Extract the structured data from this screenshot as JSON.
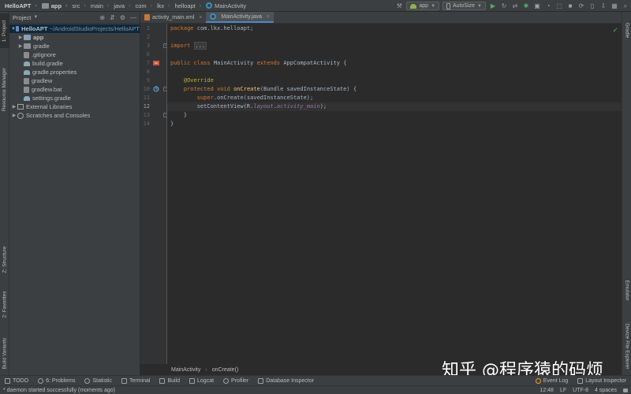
{
  "navbar": {
    "crumbs": [
      "HelloAPT",
      "app",
      "src",
      "main",
      "java",
      "com",
      "lkx",
      "helloapt",
      "MainActivity"
    ],
    "run_config": "app",
    "device": "AutoSize"
  },
  "left_strip": {
    "tabs": [
      "1: Project",
      "Resource Manager",
      "Z: Structure",
      "2: Favorites",
      "Build Variants"
    ]
  },
  "right_strip": {
    "tabs": [
      "Gradle",
      "Emulator",
      "Device File Explorer"
    ]
  },
  "project_panel": {
    "title": "Project",
    "tree": [
      {
        "label": "HelloAPT",
        "suffix": "~/AndroidStudioProjects/HelloAPT",
        "icon": "folder",
        "indent": 0,
        "expanded": true,
        "bold": true
      },
      {
        "label": "app",
        "icon": "app-folder",
        "indent": 1,
        "expanded": false,
        "bold": true
      },
      {
        "label": "gradle",
        "icon": "folder",
        "indent": 1,
        "expanded": false
      },
      {
        "label": ".gitignore",
        "icon": "file",
        "indent": 1
      },
      {
        "label": "build.gradle",
        "icon": "gradle",
        "indent": 1
      },
      {
        "label": "gradle.properties",
        "icon": "gradle",
        "indent": 1
      },
      {
        "label": "gradlew",
        "icon": "file",
        "indent": 1
      },
      {
        "label": "gradlew.bat",
        "icon": "file",
        "indent": 1
      },
      {
        "label": "settings.gradle",
        "icon": "gradle",
        "indent": 1
      },
      {
        "label": "External Libraries",
        "icon": "libs",
        "indent": 0,
        "expanded": false
      },
      {
        "label": "Scratches and Consoles",
        "icon": "scratch",
        "indent": 0,
        "expanded": false
      }
    ]
  },
  "editor": {
    "tabs": [
      {
        "label": "activity_main.xml",
        "icon": "xml-file-icon",
        "active": false
      },
      {
        "label": "MainActivity.java",
        "icon": "java-class-icon",
        "active": true
      }
    ],
    "current_line": 12,
    "line_numbers": [
      "1",
      "2",
      "3",
      "6",
      "7",
      "8",
      "9",
      "10",
      "11",
      "12",
      "13",
      "14"
    ],
    "lines": [
      {
        "n": "1",
        "text": "package com.lkx.helloapt;"
      },
      {
        "n": "2",
        "text": ""
      },
      {
        "n": "3",
        "text": "import ..."
      },
      {
        "n": "6",
        "text": ""
      },
      {
        "n": "7",
        "text": "public class MainActivity extends AppCompatActivity {"
      },
      {
        "n": "8",
        "text": ""
      },
      {
        "n": "9",
        "text": "    @Override"
      },
      {
        "n": "10",
        "text": "    protected void onCreate(Bundle savedInstanceState) {"
      },
      {
        "n": "11",
        "text": "        super.onCreate(savedInstanceState);"
      },
      {
        "n": "12",
        "text": "        setContentView(R.layout.activity_main);"
      },
      {
        "n": "13",
        "text": "    }"
      },
      {
        "n": "14",
        "text": "}"
      }
    ],
    "tokens": {
      "package_kw": "package",
      "package_name": " com.lkx.helloapt;",
      "import_kw": "import",
      "import_fold": "...",
      "public_kw": "public",
      "class_kw": "class",
      "class_name": "MainActivity",
      "extends_kw": "extends",
      "parent_class": "AppCompatActivity",
      "open_brace": " {",
      "override": "@Override",
      "protected_kw": "protected",
      "void_kw": "void",
      "method_name": "onCreate",
      "params": "(Bundle savedInstanceState) {",
      "super_kw": "super",
      "super_call": ".onCreate(savedInstanceState);",
      "set_content": "setContentView(R.",
      "layout_field": "layout",
      "dot": ".",
      "activity_field": "activity_main",
      "close_call": ");",
      "close_method": "}",
      "close_class": "}"
    },
    "breadcrumb": [
      "MainActivity",
      "onCreate()"
    ]
  },
  "watermark": "知乎 @程序猿的码烦",
  "bottom_tabs": {
    "left": [
      {
        "label": "TODO",
        "icon": "todo-icon"
      },
      {
        "label": "6: Problems",
        "icon": "problems-icon"
      },
      {
        "label": "Statistic",
        "icon": "statistic-icon"
      },
      {
        "label": "Terminal",
        "icon": "terminal-icon"
      },
      {
        "label": "Build",
        "icon": "build-icon"
      },
      {
        "label": "Logcat",
        "icon": "logcat-icon"
      },
      {
        "label": "Profiler",
        "icon": "profiler-icon"
      },
      {
        "label": "Database Inspector",
        "icon": "database-icon"
      }
    ],
    "right": [
      {
        "label": "Event Log",
        "icon": "event-log-icon"
      },
      {
        "label": "Layout Inspector",
        "icon": "layout-inspector-icon"
      }
    ]
  },
  "status_bar": {
    "message": "* daemon started successfully (moments ago)",
    "position": "12:48",
    "line_sep": "LF",
    "encoding": "UTF-8",
    "indent": "4 spaces"
  },
  "colors": {
    "keyword": "#cc7832",
    "annotation": "#bbb529",
    "method": "#ffc66d",
    "field": "#9876aa",
    "text": "#a9b7c6",
    "background": "#2b2b2b",
    "panel": "#3c3f41",
    "accent": "#4a88c7"
  }
}
